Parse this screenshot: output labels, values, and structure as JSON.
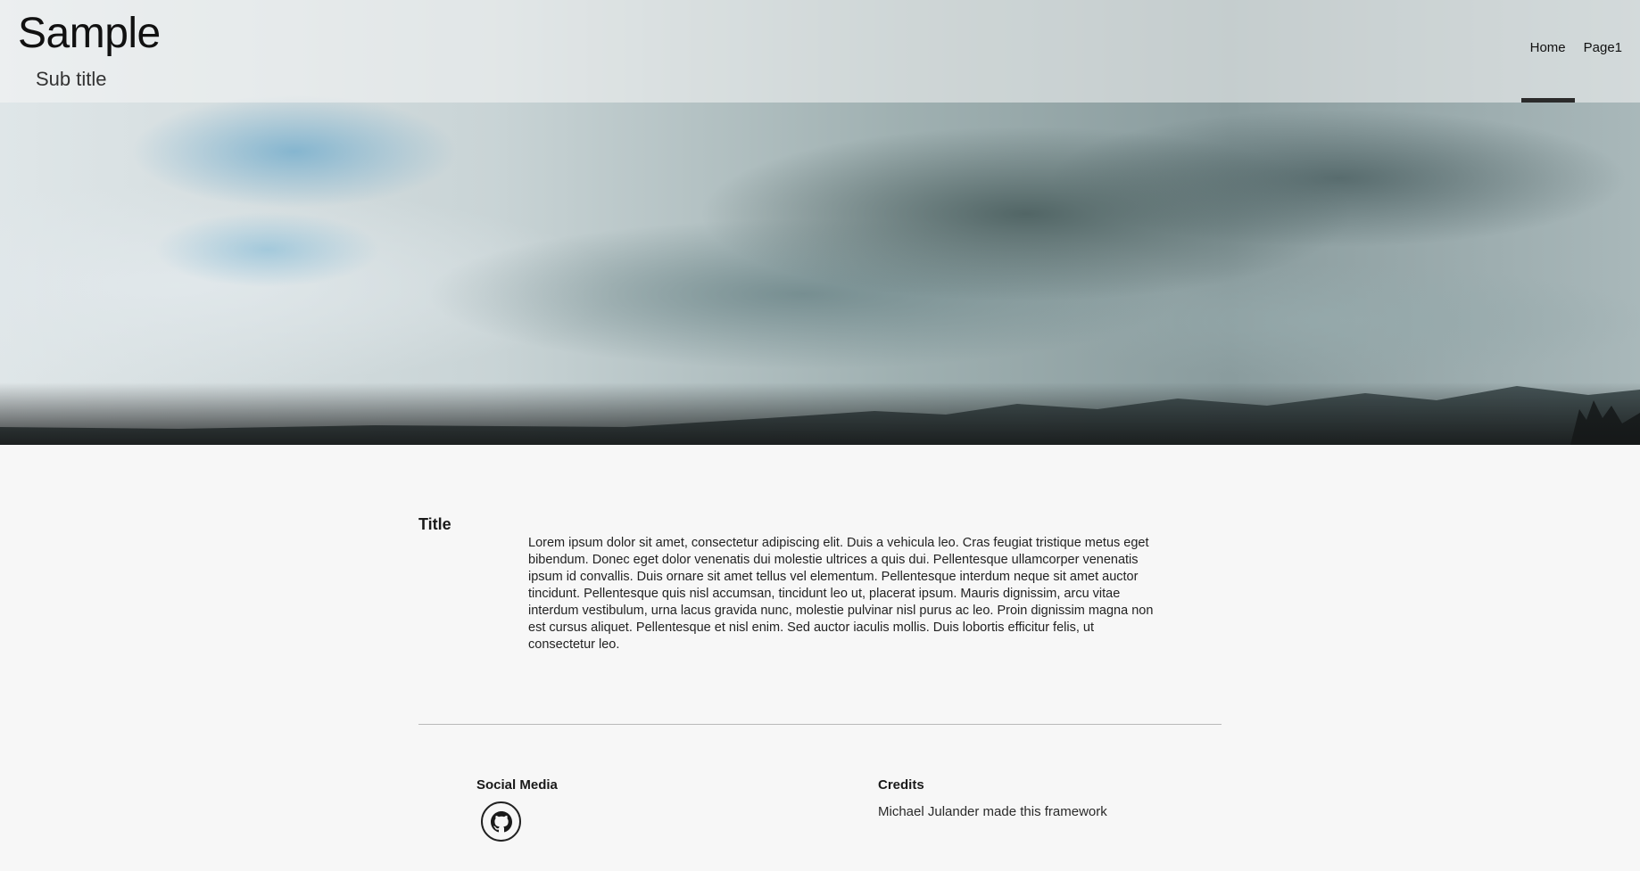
{
  "header": {
    "title": "Sample",
    "subtitle": "Sub title"
  },
  "nav": {
    "items": [
      {
        "label": "Home",
        "active": true
      },
      {
        "label": "Page1",
        "active": false
      }
    ]
  },
  "main": {
    "title": "Title",
    "body": "Lorem ipsum dolor sit amet, consectetur adipiscing elit. Duis a vehicula leo. Cras feugiat tristique metus eget bibendum. Donec eget dolor venenatis dui molestie ultrices a quis dui. Pellentesque ullamcorper venenatis ipsum id convallis. Duis ornare sit amet tellus vel elementum. Pellentesque interdum neque sit amet auctor tincidunt. Pellentesque quis nisl accumsan, tincidunt leo ut, placerat ipsum. Mauris dignissim, arcu vitae interdum vestibulum, urna lacus gravida nunc, molestie pulvinar nisl purus ac leo. Proin dignissim magna non est cursus aliquet. Pellentesque et nisl enim. Sed auctor iaculis mollis. Duis lobortis efficitur felis, ut consectetur leo."
  },
  "footer": {
    "social": {
      "heading": "Social Media",
      "icons": [
        "github-icon"
      ]
    },
    "credits": {
      "heading": "Credits",
      "text": "Michael Julander made this framework"
    }
  },
  "colors": {
    "background": "#f7f7f7",
    "nav_active_indicator": "#2b2b2b",
    "divider": "#b9b9b9"
  }
}
